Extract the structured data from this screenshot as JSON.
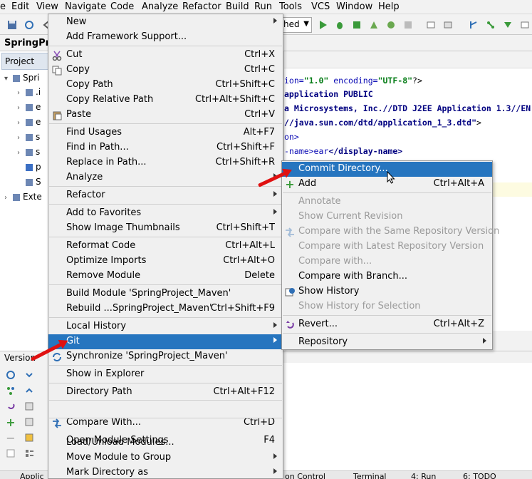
{
  "menubar": {
    "items": [
      "e",
      "Edit",
      "View",
      "Navigate",
      "Code",
      "Analyze",
      "Refactor",
      "Build",
      "Run",
      "Tools",
      "VCS",
      "Window",
      "Help"
    ]
  },
  "toolbar": {
    "run_config_text": "hed"
  },
  "breadcrumb": {
    "project": "SpringProj"
  },
  "project_panel": {
    "tab_label": "Project",
    "rows": [
      {
        "label": "Spri",
        "arrow": "▾"
      },
      {
        "label": ".i",
        "arrow": "›"
      },
      {
        "label": "e",
        "arrow": "›"
      },
      {
        "label": "e",
        "arrow": "›"
      },
      {
        "label": "s",
        "arrow": "›"
      },
      {
        "label": "s",
        "arrow": "›"
      },
      {
        "label": "p",
        "arrow": ""
      },
      {
        "label": "S",
        "arrow": ""
      },
      {
        "label": "Exte",
        "arrow": "›"
      }
    ]
  },
  "editor": {
    "lines": [
      {
        "a": "ion=",
        "b": "\"1.0\"",
        "c": " encoding=",
        "d": "\"UTF-8\"",
        "e": "?>"
      },
      {
        "a": "",
        "b": "",
        "c": "",
        "d": "application PUBLIC",
        "e": ""
      },
      {
        "a": "",
        "b": "",
        "c": "",
        "d": "a Microsystems, Inc.//DTD J2EE Application 1.3//EN",
        "e": ""
      },
      {
        "a": "",
        "b": "",
        "c": "",
        "d": "//java.sun.com/dtd/application_1_3.dtd\"",
        "e": ">"
      },
      {
        "a": "on>",
        "b": "",
        "c": "",
        "d": "",
        "e": ""
      },
      {
        "a": "-name>",
        "b": "",
        "c": "ear",
        "d": "</display-name>",
        "e": ""
      }
    ]
  },
  "vc_panel": {
    "title": "Version"
  },
  "bottom_tabs": [
    "Applic",
    "on Control",
    "Terminal",
    "4: Run",
    "6: TODO"
  ],
  "context_menu": {
    "items": [
      {
        "label": "New",
        "shortcut": "",
        "submenu": true,
        "icon": ""
      },
      {
        "label": "Add Framework Support...",
        "shortcut": "",
        "submenu": false,
        "icon": ""
      },
      {
        "sep": true
      },
      {
        "label": "Cut",
        "shortcut": "Ctrl+X",
        "submenu": false,
        "icon": "scissors-icon"
      },
      {
        "label": "Copy",
        "shortcut": "Ctrl+C",
        "submenu": false,
        "icon": "copy-icon"
      },
      {
        "label": "Copy Path",
        "shortcut": "Ctrl+Shift+C",
        "submenu": false,
        "icon": ""
      },
      {
        "label": "Copy Relative Path",
        "shortcut": "Ctrl+Alt+Shift+C",
        "submenu": false,
        "icon": ""
      },
      {
        "label": "Paste",
        "shortcut": "Ctrl+V",
        "submenu": false,
        "icon": "paste-icon"
      },
      {
        "sep": true
      },
      {
        "label": "Find Usages",
        "shortcut": "Alt+F7",
        "submenu": false,
        "icon": ""
      },
      {
        "label": "Find in Path...",
        "shortcut": "Ctrl+Shift+F",
        "submenu": false,
        "icon": ""
      },
      {
        "label": "Replace in Path...",
        "shortcut": "Ctrl+Shift+R",
        "submenu": false,
        "icon": ""
      },
      {
        "label": "Analyze",
        "shortcut": "",
        "submenu": true,
        "icon": ""
      },
      {
        "sep": true
      },
      {
        "label": "Refactor",
        "shortcut": "",
        "submenu": true,
        "icon": ""
      },
      {
        "sep": true
      },
      {
        "label": "Add to Favorites",
        "shortcut": "",
        "submenu": true,
        "icon": ""
      },
      {
        "label": "Show Image Thumbnails",
        "shortcut": "Ctrl+Shift+T",
        "submenu": false,
        "icon": ""
      },
      {
        "sep": true
      },
      {
        "label": "Reformat Code",
        "shortcut": "Ctrl+Alt+L",
        "submenu": false,
        "icon": ""
      },
      {
        "label": "Optimize Imports",
        "shortcut": "Ctrl+Alt+O",
        "submenu": false,
        "icon": ""
      },
      {
        "label": "Remove Module",
        "shortcut": "Delete",
        "submenu": false,
        "icon": ""
      },
      {
        "sep": true
      },
      {
        "label": "Build Module 'SpringProject_Maven'",
        "shortcut": "",
        "submenu": false,
        "icon": ""
      },
      {
        "label": "Rebuild ...SpringProject_Maven'",
        "shortcut": "Ctrl+Shift+F9",
        "submenu": false,
        "icon": ""
      },
      {
        "sep": true
      },
      {
        "label": "Local History",
        "shortcut": "",
        "submenu": true,
        "icon": ""
      },
      {
        "label": "Git",
        "shortcut": "",
        "submenu": true,
        "icon": "",
        "selected": true
      },
      {
        "label": "Synchronize 'SpringProject_Maven'",
        "shortcut": "",
        "submenu": false,
        "icon": "sync-icon"
      },
      {
        "sep": true
      },
      {
        "label": "Show in Explorer",
        "shortcut": "",
        "submenu": false,
        "icon": ""
      },
      {
        "sep": true
      },
      {
        "label": "Directory Path",
        "shortcut": "Ctrl+Alt+F12",
        "submenu": false,
        "icon": ""
      },
      {
        "sep": true
      },
      {
        "label": "Compare With...",
        "shortcut": "Ctrl+D",
        "submenu": false,
        "icon": "compare-icon"
      },
      {
        "sep": true
      },
      {
        "label": "Open Module Settings",
        "shortcut": "F4",
        "submenu": false,
        "icon": ""
      },
      {
        "label": "Load/Unload Modules...",
        "shortcut": "",
        "submenu": false,
        "icon": ""
      },
      {
        "label": "Move Module to Group",
        "shortcut": "",
        "submenu": true,
        "icon": ""
      },
      {
        "label": "Mark Directory as",
        "shortcut": "",
        "submenu": true,
        "icon": ""
      }
    ]
  },
  "git_menu": {
    "items": [
      {
        "label": "Commit Directory...",
        "shortcut": "",
        "disabled": false,
        "selected": true,
        "icon": ""
      },
      {
        "label": "Add",
        "shortcut": "Ctrl+Alt+A",
        "disabled": false,
        "icon": "plus-icon"
      },
      {
        "sep": true
      },
      {
        "label": "Annotate",
        "shortcut": "",
        "disabled": true,
        "icon": ""
      },
      {
        "label": "Show Current Revision",
        "shortcut": "",
        "disabled": true,
        "icon": ""
      },
      {
        "label": "Compare with the Same Repository Version",
        "shortcut": "",
        "disabled": true,
        "icon": "compare-icon"
      },
      {
        "label": "Compare with Latest Repository Version",
        "shortcut": "",
        "disabled": true,
        "icon": ""
      },
      {
        "label": "Compare with...",
        "shortcut": "",
        "disabled": true,
        "icon": ""
      },
      {
        "label": "Compare with Branch...",
        "shortcut": "",
        "disabled": false,
        "icon": ""
      },
      {
        "label": "Show History",
        "shortcut": "",
        "disabled": false,
        "icon": "history-icon"
      },
      {
        "label": "Show History for Selection",
        "shortcut": "",
        "disabled": true,
        "icon": ""
      },
      {
        "sep": true
      },
      {
        "label": "Revert...",
        "shortcut": "Ctrl+Alt+Z",
        "disabled": false,
        "icon": "revert-icon"
      },
      {
        "sep": true
      },
      {
        "label": "Repository",
        "shortcut": "",
        "disabled": false,
        "submenu": true,
        "icon": ""
      }
    ]
  },
  "colors": {
    "selection": "#2675bf",
    "menu_bg": "#f0f0f0",
    "disabled_text": "#9a9a9a",
    "annotation_arrow": "#e01010"
  }
}
